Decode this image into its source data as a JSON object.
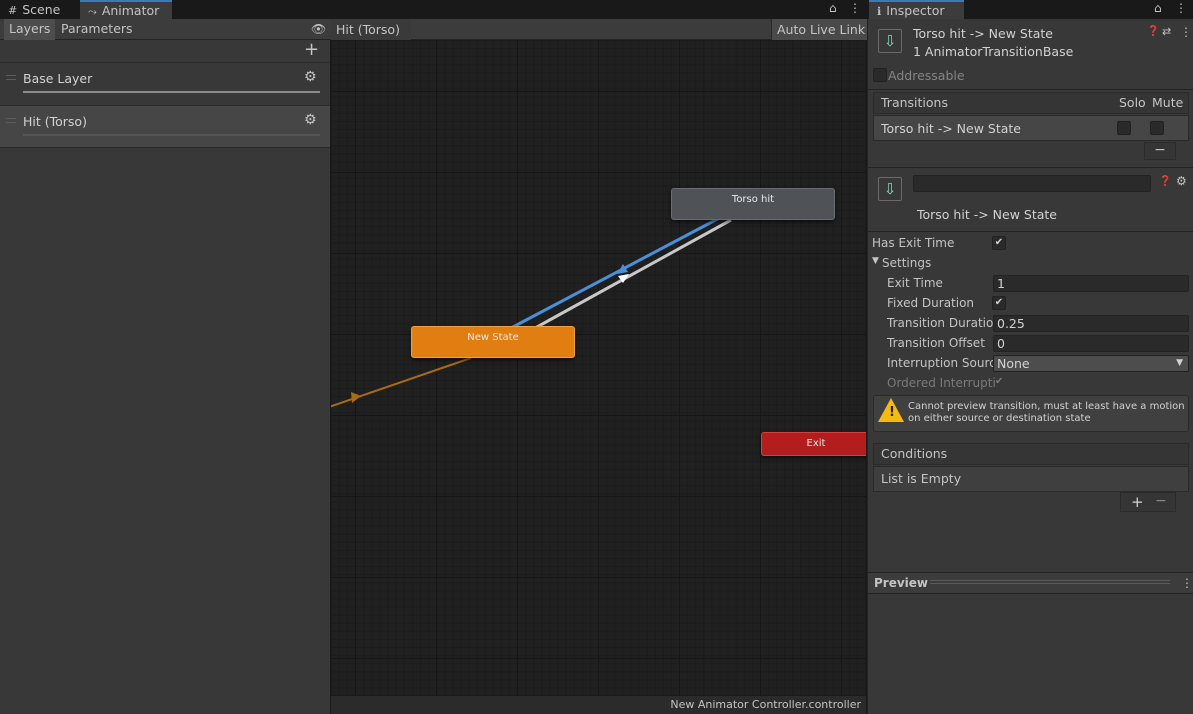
{
  "tabs": {
    "scene": "Scene",
    "animator": "Animator",
    "inspector": "Inspector"
  },
  "animator": {
    "subtabs": [
      "Layers",
      "Parameters"
    ],
    "breadcrumb": "Hit (Torso)",
    "auto_live_link": "Auto Live Link",
    "layers": [
      {
        "name": "Base Layer"
      },
      {
        "name": "Hit (Torso)"
      }
    ],
    "nodes": {
      "torso_hit": "Torso hit",
      "new_state": "New State",
      "exit": "Exit"
    },
    "status": "New Animator Controller.controller",
    "colors": {
      "new_state": "#e07e11",
      "torso_hit": "#4f5358",
      "exit": "#b31d1d",
      "transition_selected": "#4a90d9",
      "entry_transition": "#a86c14"
    }
  },
  "inspector": {
    "header_title": "Torso hit -> New State",
    "header_subtitle": "1 AnimatorTransitionBase",
    "addressable": "Addressable",
    "transitions_label": "Transitions",
    "solo_label": "Solo",
    "mute_label": "Mute",
    "transition_row": "Torso hit -> New State",
    "minus": "−",
    "sub_title": "Torso hit -> New State",
    "has_exit_time_label": "Has Exit Time",
    "settings_label": "Settings",
    "exit_time_label": "Exit Time",
    "exit_time_value": "1",
    "fixed_duration_label": "Fixed Duration",
    "transition_duration_label": "Transition Duratio",
    "transition_duration_value": "0.25",
    "transition_offset_label": "Transition Offset",
    "transition_offset_value": "0",
    "interruption_source_label": "Interruption Sourc",
    "interruption_source_value": "None",
    "ordered_interruption_label": "Ordered Interrupti",
    "warning": "Cannot preview transition, must at least have a motion on either source or destination state",
    "conditions_label": "Conditions",
    "conditions_empty": "List is Empty",
    "plus": "+",
    "preview_label": "Preview"
  }
}
